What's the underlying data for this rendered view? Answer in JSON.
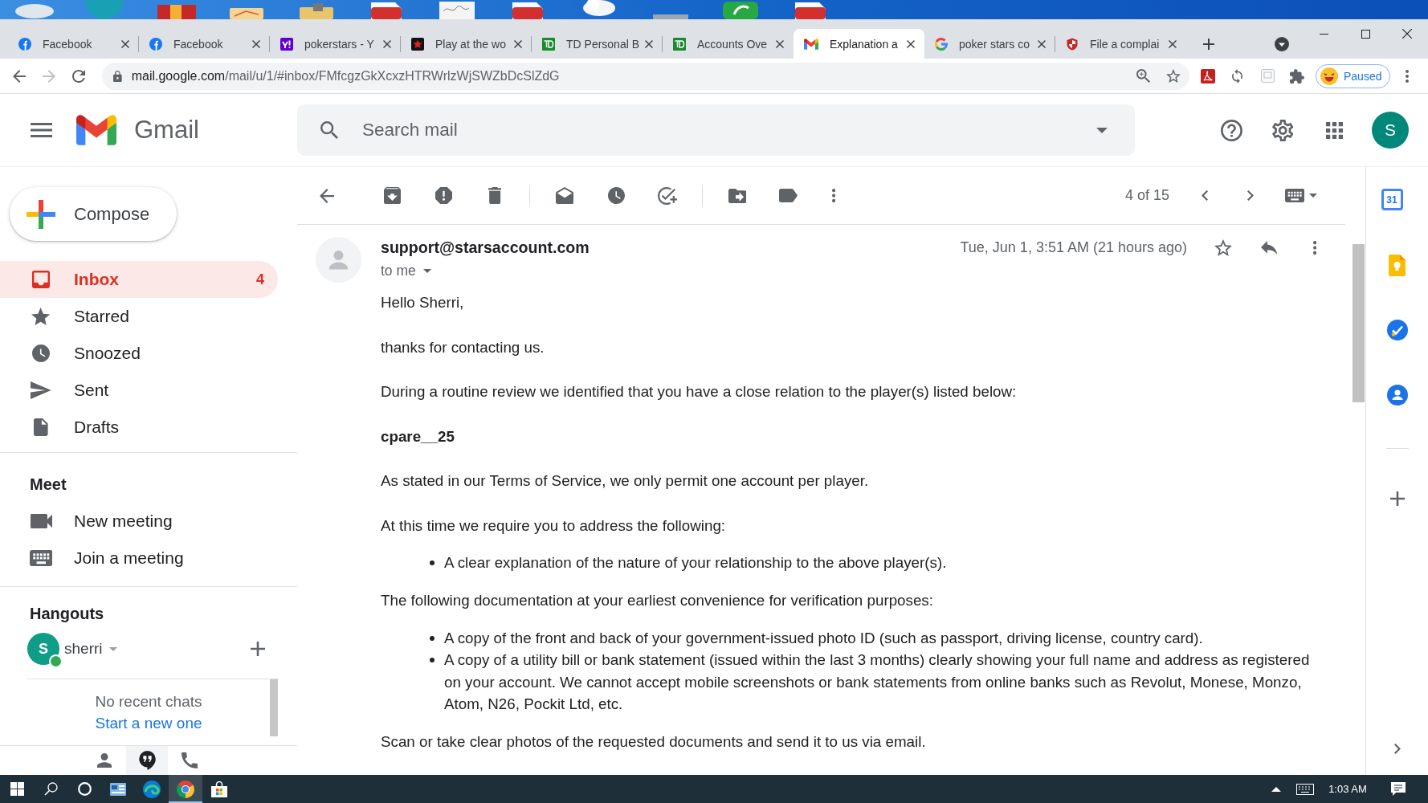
{
  "browser": {
    "tabs": [
      {
        "kind": "facebook",
        "title": "Facebook",
        "selected": false
      },
      {
        "kind": "facebook",
        "title": "Facebook",
        "selected": false
      },
      {
        "kind": "yahoo",
        "title": "pokerstars - Y",
        "selected": false
      },
      {
        "kind": "stars",
        "title": "Play at the wo",
        "selected": false
      },
      {
        "kind": "td",
        "title": "TD Personal B",
        "selected": false
      },
      {
        "kind": "td",
        "title": "Accounts Ove",
        "selected": false
      },
      {
        "kind": "gmail",
        "title": "Explanation a",
        "selected": true
      },
      {
        "kind": "google",
        "title": "poker stars co",
        "selected": false
      },
      {
        "kind": "shield",
        "title": "File a complai",
        "selected": false
      }
    ],
    "url": {
      "host": "mail.google.com",
      "path": "/mail/u/1/#inbox/FMfcgzGkXcxzHTRWrlzWjSWZbDcSlZdG"
    },
    "profile": {
      "status": "Paused"
    }
  },
  "header": {
    "product": "Gmail",
    "search": {
      "placeholder": "Search mail"
    },
    "account": {
      "initial": "S"
    }
  },
  "sidebar": {
    "compose": "Compose",
    "folders": [
      {
        "kind": "inbox",
        "label": "Inbox",
        "count": "4",
        "selected": true
      },
      {
        "kind": "starred",
        "label": "Starred",
        "selected": false
      },
      {
        "kind": "snoozed",
        "label": "Snoozed",
        "selected": false
      },
      {
        "kind": "sent",
        "label": "Sent",
        "selected": false
      },
      {
        "kind": "drafts",
        "label": "Drafts",
        "selected": false
      }
    ],
    "meet": {
      "title": "Meet",
      "items": [
        {
          "kind": "video",
          "label": "New meeting"
        },
        {
          "kind": "keyboard",
          "label": "Join a meeting"
        }
      ]
    },
    "hangouts": {
      "title": "Hangouts",
      "user": {
        "initial": "S",
        "name": "sherri",
        "online": true
      },
      "empty_message": "No recent chats",
      "start_link": "Start a new one"
    },
    "bottom_tabs": [
      {
        "kind": "contacts",
        "selected": false
      },
      {
        "kind": "chat",
        "selected": true
      },
      {
        "kind": "phone",
        "selected": false
      }
    ]
  },
  "toolbar": {
    "position": "4 of 15"
  },
  "message": {
    "sender": "support@starsaccount.com",
    "recipients": "to me",
    "date": "Tue, Jun 1, 3:51 AM (21 hours ago)",
    "starred": false,
    "body": [
      {
        "kind": "paragraph",
        "text": "Hello Sherri,"
      },
      {
        "kind": "paragraph",
        "text": "thanks for contacting us."
      },
      {
        "kind": "paragraph",
        "text": "During a routine review we identified that you have a close relation to the player(s) listed below:"
      },
      {
        "kind": "heading",
        "text": "cpare__25"
      },
      {
        "kind": "paragraph",
        "text": "As stated in our Terms of Service, we only permit one account per player."
      },
      {
        "kind": "paragraph",
        "text": "At this time we require you to address the following:"
      },
      {
        "kind": "list",
        "items": [
          "A clear explanation of the nature of your relationship to the above player(s)."
        ]
      },
      {
        "kind": "paragraph",
        "text": "The following documentation at your earliest convenience for verification purposes:"
      },
      {
        "kind": "list",
        "items": [
          "A copy of the front and back of your government-issued photo ID (such as passport, driving license, country card).",
          "A copy of a utility bill or bank statement (issued within the last 3 months) clearly showing your full name and address as registered on your account. We cannot accept mobile screenshots or bank statements from online banks such as Revolut, Monese, Monzo, Atom, N26, Pockit Ltd, etc."
        ]
      },
      {
        "kind": "paragraph",
        "text": "Scan or take clear photos of the requested documents and send it to us via email."
      }
    ]
  },
  "side_panel": {
    "apps": [
      {
        "kind": "calendar",
        "badge": "31"
      },
      {
        "kind": "keep"
      },
      {
        "kind": "tasks"
      },
      {
        "kind": "contacts"
      }
    ]
  },
  "taskbar": {
    "apps": [
      {
        "kind": "search",
        "selected": false
      },
      {
        "kind": "cortana",
        "selected": false
      },
      {
        "kind": "app",
        "selected": false
      },
      {
        "kind": "edge",
        "selected": false
      },
      {
        "kind": "chrome",
        "selected": true
      },
      {
        "kind": "store",
        "selected": false
      }
    ],
    "clock": "1:03 AM"
  }
}
